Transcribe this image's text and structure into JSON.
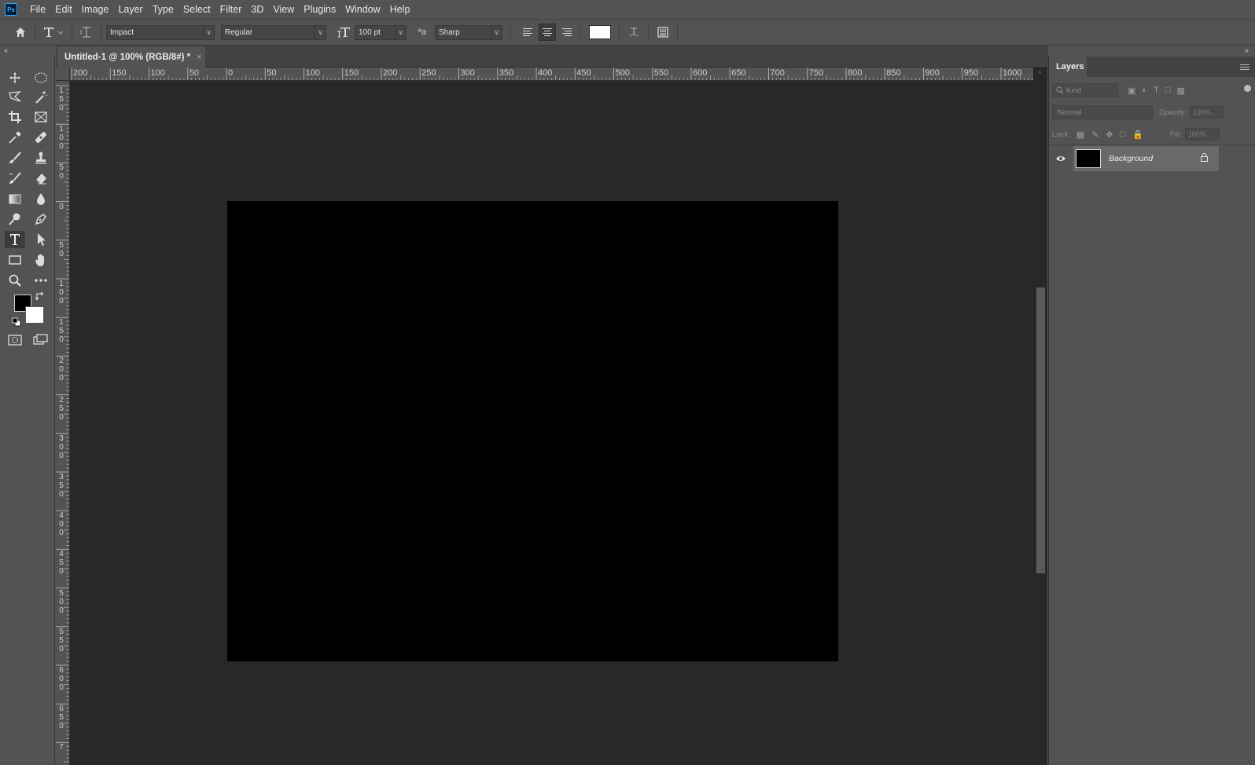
{
  "app": {
    "logo_text": "Ps"
  },
  "menu": [
    "File",
    "Edit",
    "Image",
    "Layer",
    "Type",
    "Select",
    "Filter",
    "3D",
    "View",
    "Plugins",
    "Window",
    "Help"
  ],
  "options": {
    "font_family": "Impact",
    "font_style": "Regular",
    "font_size": "100 pt",
    "antialias_icon_text": "ªa",
    "antialias": "Sharp",
    "text_color": "#ffffff"
  },
  "document": {
    "tab_title": "Untitled-1 @ 100% (RGB/8#) *",
    "close": "×",
    "canvas_color": "#000000"
  },
  "ruler_h_labels": [
    "200",
    "150",
    "100",
    "50",
    "0",
    "50",
    "100",
    "150",
    "200",
    "250",
    "300",
    "350",
    "400",
    "450",
    "500",
    "550",
    "600",
    "650",
    "700",
    "750",
    "800",
    "850",
    "900",
    "950",
    "1000"
  ],
  "ruler_v_labels": [
    "150",
    "100",
    "50",
    "0",
    "50",
    "100",
    "150",
    "200",
    "250",
    "300",
    "350",
    "400",
    "450",
    "500",
    "550",
    "600",
    "650",
    "7"
  ],
  "tools": {
    "foreground_color": "#000000",
    "background_color": "#ffffff"
  },
  "layers_panel": {
    "tab": "Layers",
    "filter_kind": "Kind",
    "blend_mode": "Normal",
    "opacity_label": "Opacity:",
    "opacity_value": "100%",
    "lock_label": "Lock:",
    "fill_label": "Fill:",
    "fill_value": "100%",
    "layers": [
      {
        "name": "Background",
        "visible": true,
        "locked": true
      }
    ]
  }
}
